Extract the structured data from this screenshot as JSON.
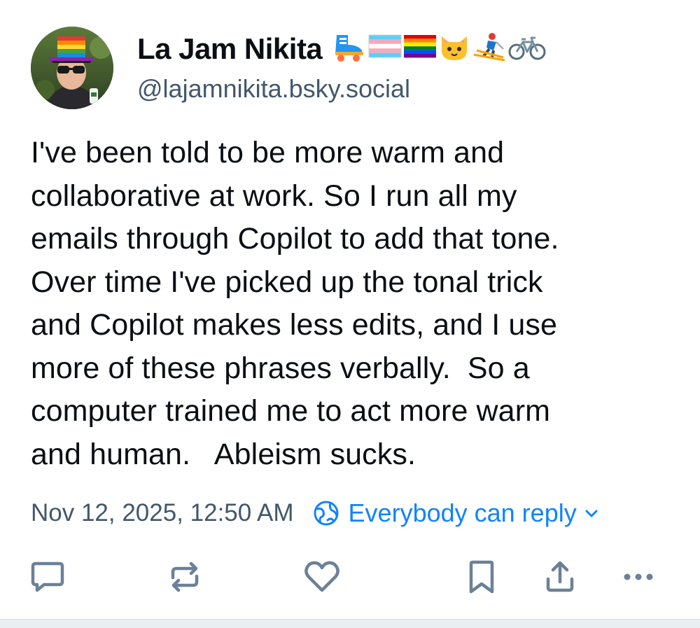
{
  "author": {
    "display_name": "La Jam Nikita",
    "name_emojis": [
      "roller-skate",
      "transgender-flag",
      "rainbow-flag",
      "cat-face",
      "skier",
      "bicycle"
    ],
    "handle": "@lajamnikita.bsky.social"
  },
  "post": {
    "text": "I've been told to be more warm and\ncollaborative at work. So I run all my\nemails through Copilot to add that tone.\nOver time I've picked up the tonal trick\nand Copilot makes less edits, and I use\nmore of these phrases verbally.  So a\ncomputer trained me to act more warm\nand human.   Ableism sucks.",
    "timestamp": "Nov 12, 2025, 12:50 AM",
    "reply_setting": "Everybody can reply"
  },
  "actions": {
    "icons": [
      "reply-icon",
      "repost-icon",
      "like-icon",
      "bookmark-icon",
      "share-icon",
      "more-icon"
    ]
  },
  "colors": {
    "text": "#0b0f14",
    "muted": "#42576c",
    "accent": "#1083fe",
    "icon": "#6b8198"
  }
}
